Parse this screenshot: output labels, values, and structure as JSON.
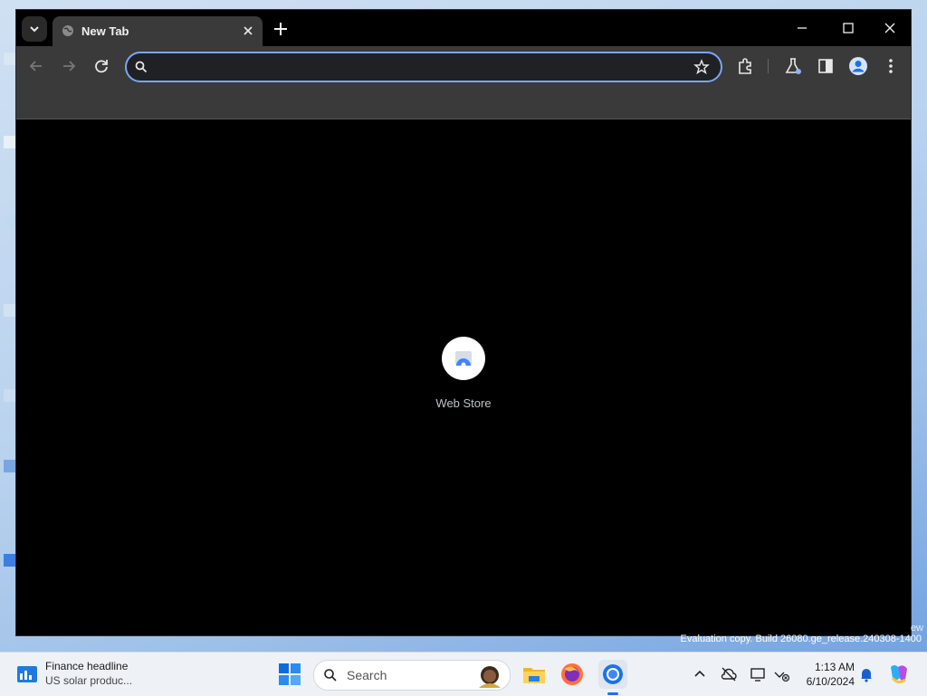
{
  "browser": {
    "tab": {
      "title": "New Tab"
    },
    "omnibox": {
      "value": "",
      "placeholder": ""
    },
    "shortcuts": [
      {
        "label": "Web Store"
      }
    ]
  },
  "desktop": {
    "watermark": "Evaluation copy. Build 26080.ge_release.240308-1400",
    "watermark_edge": "ew"
  },
  "taskbar": {
    "widget": {
      "title": "Finance headline",
      "subtitle": "US solar produc..."
    },
    "search": {
      "label": "Search"
    },
    "clock": {
      "time": "1:13 AM",
      "date": "6/10/2024"
    }
  },
  "colors": {
    "accent": "#1a73e8",
    "omnibox_focus": "#7aa7f5",
    "toolbar": "#3a3a3a",
    "page_bg": "#000000"
  },
  "icons": [
    "tab-search-icon",
    "globe-icon",
    "close-icon",
    "plus-icon",
    "minimize-icon",
    "maximize-icon",
    "back-icon",
    "forward-icon",
    "reload-icon",
    "search-icon",
    "star-icon",
    "extensions-icon",
    "labs-icon",
    "side-panel-icon",
    "profile-icon",
    "more-icon",
    "web-store-icon",
    "widgets-icon",
    "windows-icon",
    "file-explorer-icon",
    "firefox-icon",
    "chrome-icon",
    "chevron-up-icon",
    "cloud-off-icon",
    "display-icon",
    "network-icon",
    "bell-icon",
    "copilot-icon"
  ]
}
